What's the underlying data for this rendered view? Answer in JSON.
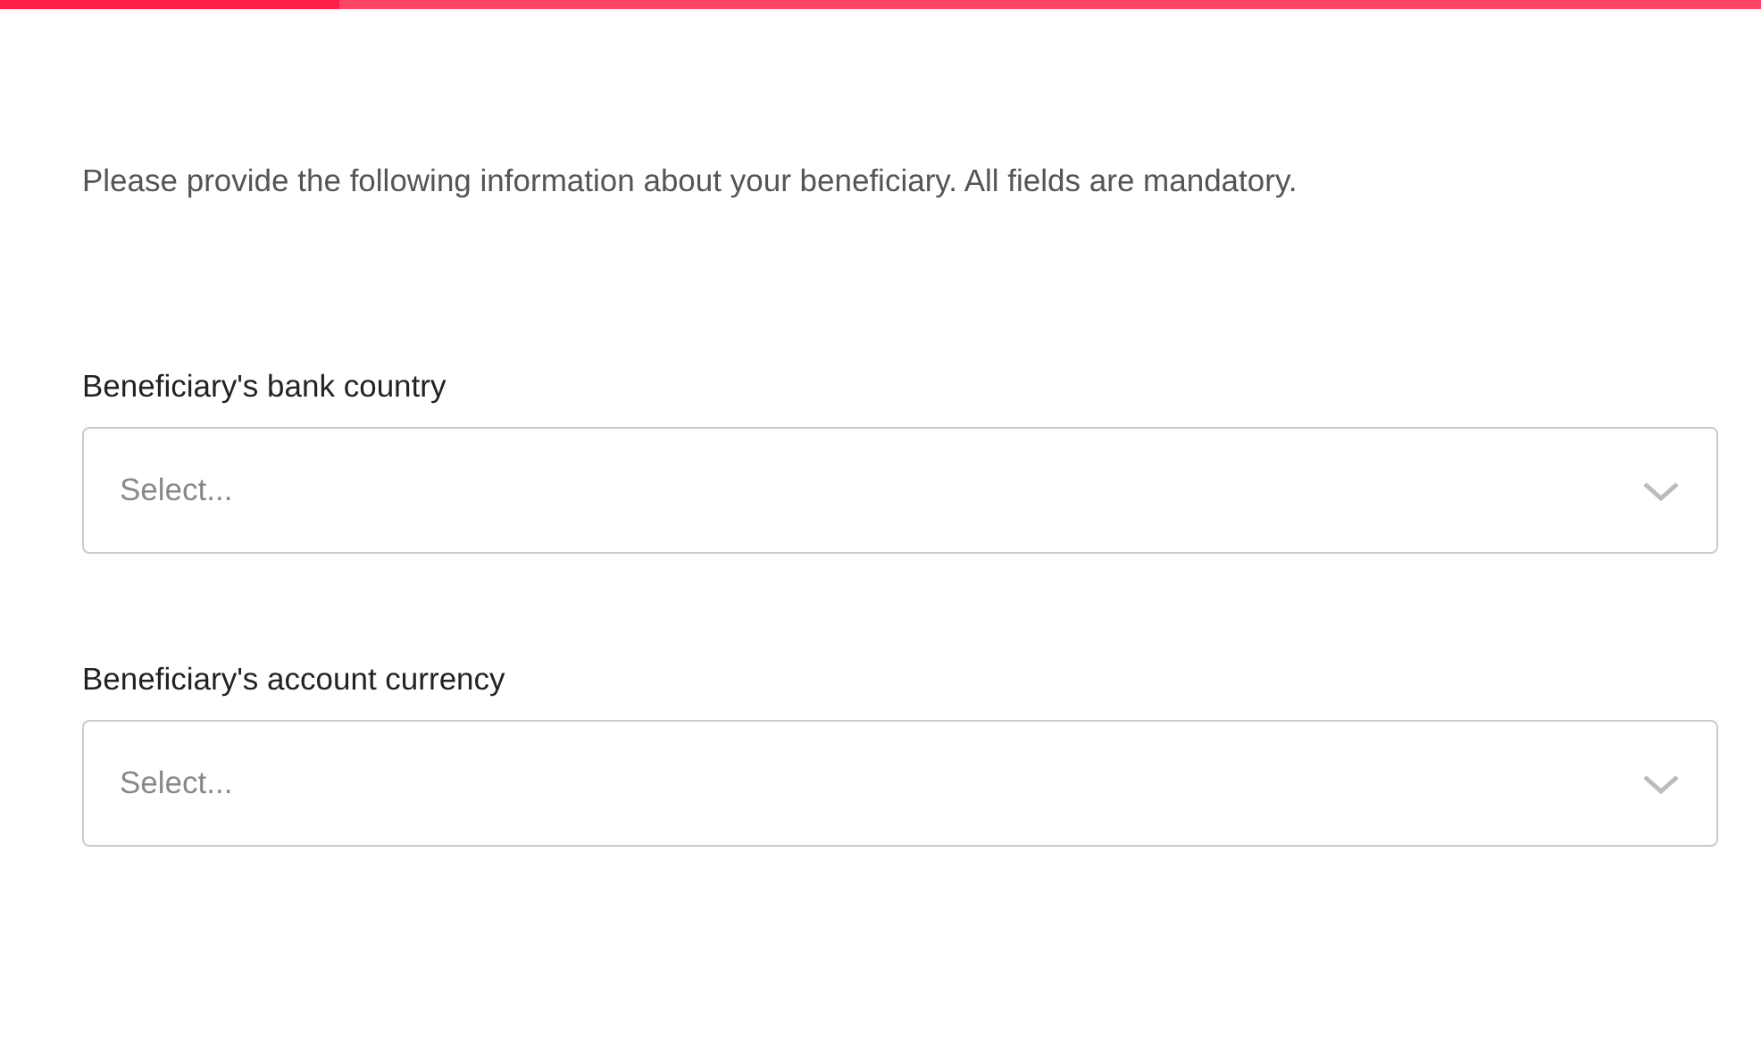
{
  "progress": {
    "level": 0.193
  },
  "intro": "Please provide the following information about your beneficiary. All fields are mandatory.",
  "fields": [
    {
      "label": "Beneficiary's bank country",
      "placeholder": "Select..."
    },
    {
      "label": "Beneficiary's account currency",
      "placeholder": "Select..."
    }
  ]
}
